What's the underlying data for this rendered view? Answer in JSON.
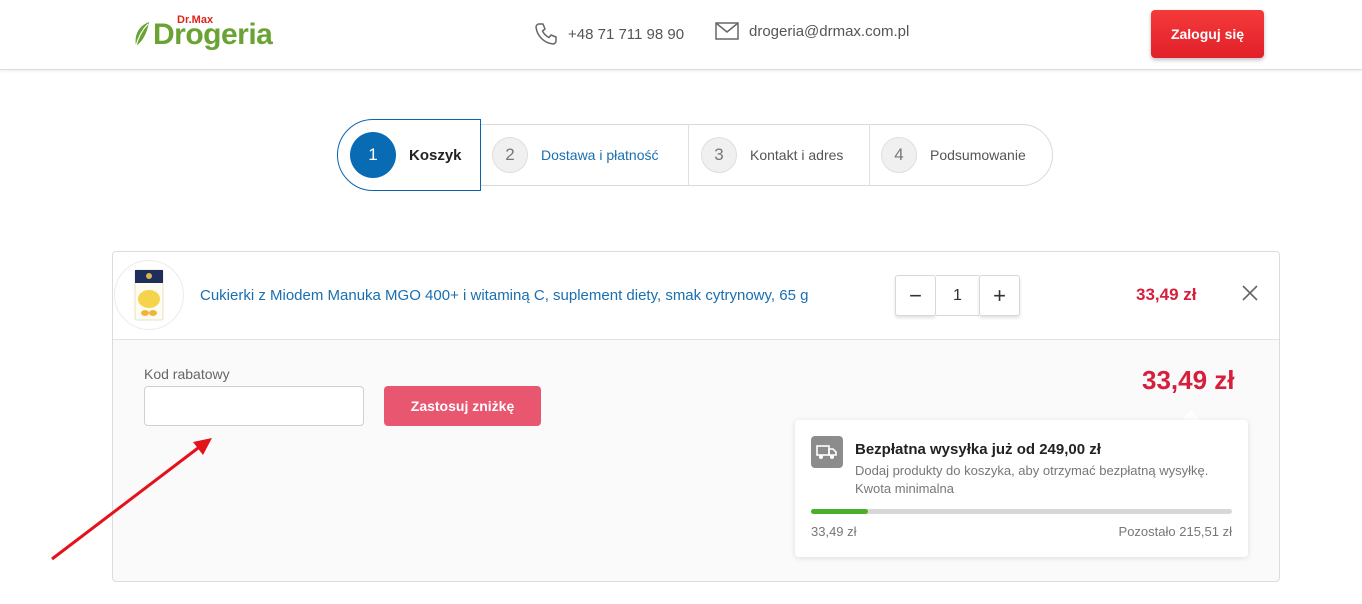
{
  "header": {
    "logo_brand": "Dr.Max",
    "logo_name": "Drogeria",
    "phone": "+48 71 711 98 90",
    "email": "drogeria@drmax.com.pl",
    "login_label": "Zaloguj się",
    "icons": {
      "phone": "phone-icon",
      "email": "envelope-icon"
    }
  },
  "steps": [
    {
      "number": "1",
      "label": "Koszyk",
      "active": true
    },
    {
      "number": "2",
      "label": "Dostawa i płatność",
      "active": false
    },
    {
      "number": "3",
      "label": "Kontakt i adres",
      "active": false
    },
    {
      "number": "4",
      "label": "Podsumowanie",
      "active": false
    }
  ],
  "cart": {
    "item": {
      "name": "Cukierki z Miodem Manuka MGO 400+ i witaminą C, suplement diety, smak cytrynowy, 65 g",
      "quantity": "1",
      "minus": "−",
      "plus": "+",
      "price": "33,49 zł"
    },
    "discount": {
      "label": "Kod rabatowy",
      "value": "",
      "button_label": "Zastosuj zniżkę"
    },
    "total": "33,49 zł",
    "shipping": {
      "title": "Bezpłatna wysyłka już od 249,00 zł",
      "description": "Dodaj produkty do koszyka, aby otrzymać bezpłatną wysyłkę. Kwota minimalna",
      "progress_fraction": 0.1345,
      "current": "33,49 zł",
      "remaining": "Pozostało 215,51 zł"
    }
  },
  "colors": {
    "primary_blue": "#0a6bb5",
    "price_red": "#d61f3c",
    "login_red": "#e2202a",
    "discount_button": "#e9566f",
    "progress_green": "#4caf2a",
    "logo_green": "#6aa334"
  }
}
